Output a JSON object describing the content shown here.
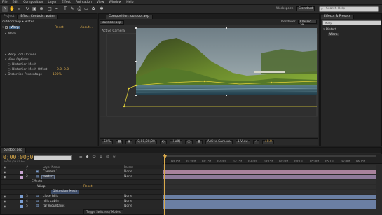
{
  "menu": [
    "File",
    "Edit",
    "Composition",
    "Layer",
    "Effect",
    "Animation",
    "View",
    "Window",
    "Help"
  ],
  "toolbar": {
    "workspace_label": "Workspace:",
    "workspace_value": "Standard",
    "search_placeholder": "Search Help"
  },
  "left_panel": {
    "tabs": [
      "Project",
      "Effect Controls: water"
    ],
    "header": "outdoor.aep • water",
    "effect": {
      "name": "Warp",
      "reset": "Reset",
      "about": "About..."
    },
    "props": [
      {
        "label": "Mesh",
        "value": ""
      },
      {
        "label": "Warp Tool Options",
        "value": ""
      },
      {
        "label": "View Options",
        "value": ""
      },
      {
        "label": "Distortion Mesh",
        "value": ""
      },
      {
        "label": "Distortion Mesh Offset",
        "value": "0.0, 0.0"
      },
      {
        "label": "Distortion Percentage",
        "value": "100%"
      }
    ]
  },
  "comp_panel": {
    "tab": "Composition: outdoor.aep",
    "comp_chip": "outdoor.aep",
    "renderer_label": "Renderer:",
    "renderer_value": "Classic 3D",
    "camera_label": "Active Camera",
    "bottom": {
      "zoom": "50%",
      "timecode": "0;00;00;00",
      "resolution": "(Half)",
      "view": "Active Camera",
      "views": "1 View",
      "exposure": "+0.0"
    }
  },
  "right_panel": {
    "tab": "Effects & Presets",
    "search_value": "warp",
    "group": "Distort",
    "item": "Warp"
  },
  "timeline": {
    "tab": "outdoor.aep",
    "timecode": "0;00;00;00",
    "timecode_sub": "00000 (29.97 fps)",
    "search_placeholder": "",
    "columns": {
      "source": "Layer Name",
      "mode": "Parent"
    },
    "layers": [
      {
        "num": "1",
        "name": "Camera 1",
        "mode": "None",
        "color": "#c7a3d1"
      },
      {
        "num": "2",
        "name": "water",
        "mode": "None",
        "color": "#c7a3d1"
      }
    ],
    "sub_layers": [
      {
        "label": "Effects",
        "value": ""
      },
      {
        "label": "Warp",
        "value": "Reset"
      },
      {
        "label": "Distortion Mesh",
        "value": ""
      }
    ],
    "lower_layers": [
      {
        "num": "3",
        "name": "close hills",
        "mode": "None",
        "color": "#7b9ed1"
      },
      {
        "num": "4",
        "name": "hills cabin",
        "mode": "None",
        "color": "#7b9ed1"
      },
      {
        "num": "5",
        "name": "far mountains",
        "mode": "None",
        "color": "#7b9ed1"
      }
    ],
    "ruler_ticks": [
      "00:15f",
      "01:00f",
      "01:15f",
      "02:00f",
      "02:15f",
      "03:00f",
      "03:15f",
      "04:00f",
      "04:15f",
      "05:00f",
      "05:15f",
      "06:00f",
      "06:15f"
    ],
    "toggle_label": "Toggle Switches / Modes"
  }
}
